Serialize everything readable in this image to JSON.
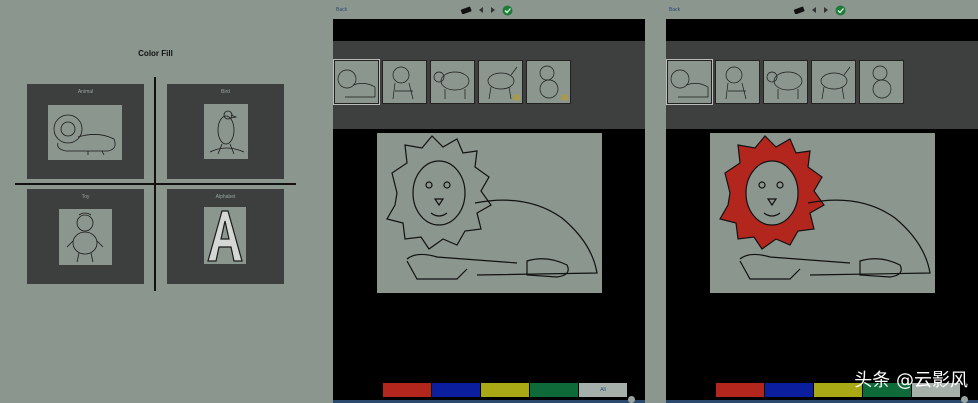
{
  "home": {
    "title": "Color Fill",
    "categories": [
      {
        "label": "Animal"
      },
      {
        "label": "Bird"
      },
      {
        "label": "Toy"
      },
      {
        "label": "Alphabet"
      }
    ]
  },
  "editor_left": {
    "back_label": "Back",
    "palette": {
      "all_label": "All"
    }
  },
  "editor_right": {
    "back_label": "Back"
  },
  "colors": {
    "red": "#b3261e",
    "blue": "#0b1f9e",
    "yellow": "#a8a914",
    "green": "#0f6a39",
    "background": "#8b968f"
  },
  "watermark": {
    "text": "头条 @云影风"
  }
}
